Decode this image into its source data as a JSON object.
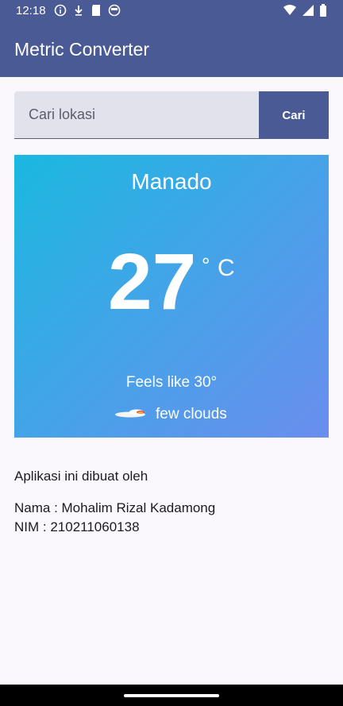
{
  "status_bar": {
    "time": "12:18",
    "left_icons": [
      "info-icon",
      "download-icon",
      "sd-card-icon",
      "face-icon"
    ],
    "right_icons": [
      "wifi-icon",
      "signal-icon",
      "battery-icon"
    ]
  },
  "app_bar": {
    "title": "Metric Converter",
    "color": "#4a5a95"
  },
  "search": {
    "placeholder": "Cari lokasi",
    "value": "",
    "button_label": "Cari"
  },
  "weather": {
    "city": "Manado",
    "temperature": "27",
    "degree_symbol": "°",
    "unit": "C",
    "feels_like": "Feels like 30°",
    "condition": "few clouds",
    "condition_icon": "few-clouds-icon",
    "gradient": [
      "#1ab8e0",
      "#6a8eee"
    ]
  },
  "credit": {
    "intro": "Aplikasi ini dibuat oleh",
    "name": "Nama : Mohalim Rizal Kadamong",
    "nim": "NIM : 210211060138"
  }
}
